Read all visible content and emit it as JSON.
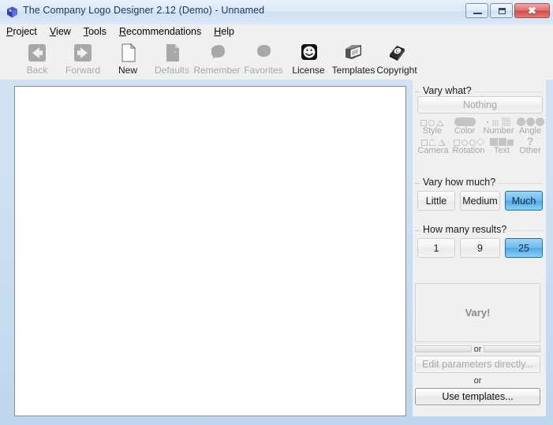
{
  "window": {
    "title": "The Company Logo Designer 2.12 (Demo) - Unnamed",
    "app_icon": "logo-cube-icon",
    "minimize_label": "",
    "maximize_label": "",
    "close_label": "✖"
  },
  "menubar": {
    "items": [
      {
        "mnemonic": "P",
        "rest": "roject"
      },
      {
        "mnemonic": "V",
        "rest": "iew"
      },
      {
        "mnemonic": "T",
        "rest": "ools"
      },
      {
        "mnemonic": "R",
        "rest": "ecommendations"
      },
      {
        "mnemonic": "H",
        "rest": "elp"
      }
    ]
  },
  "toolbar": {
    "buttons": [
      {
        "label": "Back",
        "icon": "back-arrow-icon",
        "enabled": false
      },
      {
        "label": "Forward",
        "icon": "forward-arrow-icon",
        "enabled": false
      },
      {
        "label": "New",
        "icon": "new-document-icon",
        "enabled": true
      },
      {
        "label": "Defaults",
        "icon": "defaults-document-icon",
        "enabled": false
      },
      {
        "label": "Remember",
        "icon": "remember-blob-icon",
        "enabled": false
      },
      {
        "label": "Favorites",
        "icon": "favorites-blob-icon",
        "enabled": false
      },
      {
        "label": "License",
        "icon": "smiley-face-icon",
        "enabled": true
      },
      {
        "label": "Templates",
        "icon": "templates-folder-icon",
        "enabled": true
      },
      {
        "label": "Copyright",
        "icon": "copyright-book-icon",
        "enabled": true
      }
    ]
  },
  "canvas": {
    "name": "logo-preview-canvas",
    "background": "#ffffff"
  },
  "sidebar": {
    "vary_what": {
      "title": "Vary what?",
      "nothing_button": "Nothing",
      "options": [
        {
          "label": "Style",
          "icon": "style-shapes-icon"
        },
        {
          "label": "Color",
          "icon": "color-pill-icon"
        },
        {
          "label": "Number",
          "icon": "number-dots-icon"
        },
        {
          "label": "Angle",
          "icon": "angle-blobs-icon"
        },
        {
          "label": "Camera",
          "icon": "camera-shapes-icon"
        },
        {
          "label": "Rotation",
          "icon": "rotation-shapes-icon"
        },
        {
          "label": "Text",
          "icon": "text-blocks-icon"
        },
        {
          "label": "Other",
          "icon": "other-question-icon"
        }
      ]
    },
    "vary_how_much": {
      "title": "Vary how much?",
      "options": [
        {
          "label": "Little",
          "selected": false
        },
        {
          "label": "Medium",
          "selected": false
        },
        {
          "label": "Much",
          "selected": true
        }
      ]
    },
    "how_many_results": {
      "title": "How many results?",
      "options": [
        {
          "label": "1",
          "selected": false
        },
        {
          "label": "9",
          "selected": false
        },
        {
          "label": "25",
          "selected": true
        }
      ]
    },
    "actions": {
      "vary_button": "Vary!",
      "or_1": "or",
      "edit_parameters_button": "Edit parameters directly...",
      "or_2": "or",
      "use_templates_button": "Use templates..."
    }
  },
  "colors": {
    "accent_selected": "#4aabe9",
    "panel_bg": "#f0f0f0",
    "canvas_bg": "#ffffff",
    "titlebar_text": "#123a67",
    "disabled_text": "#a8a8a8",
    "window_frame": "#bed7ee"
  }
}
